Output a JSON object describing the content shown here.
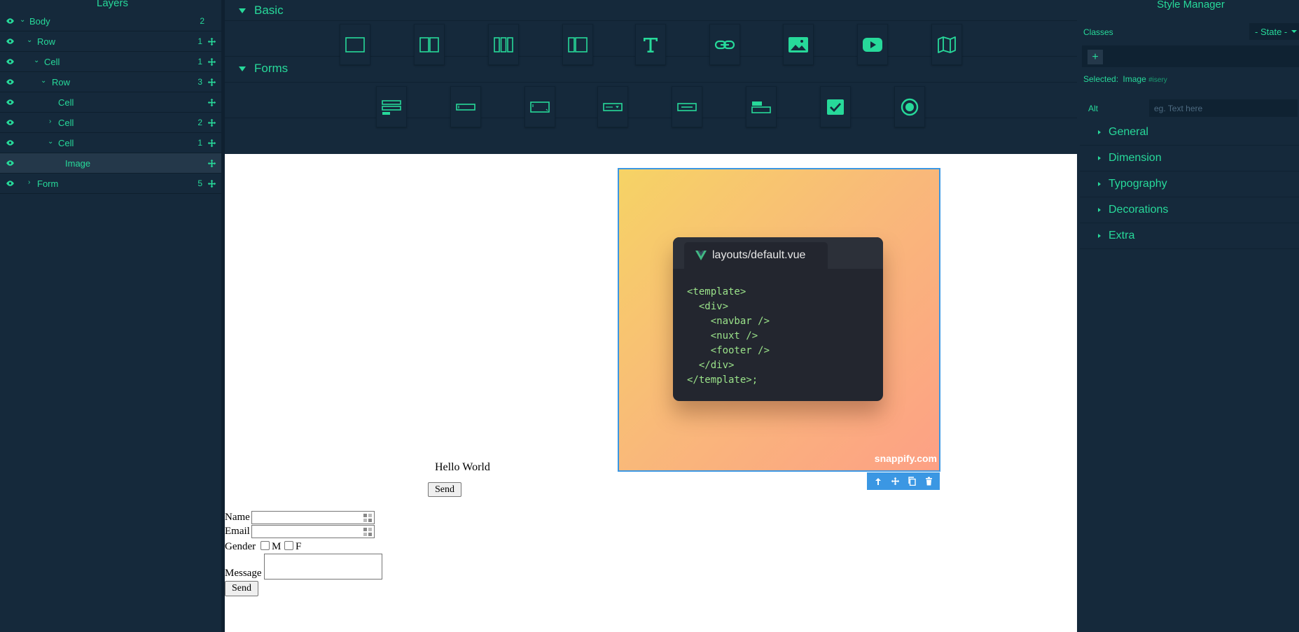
{
  "layers_panel": {
    "title": "Layers",
    "rows": [
      {
        "name": "Body",
        "count": "2"
      },
      {
        "name": "Row",
        "count": "1"
      },
      {
        "name": "Cell",
        "count": "1"
      },
      {
        "name": "Row",
        "count": "3"
      },
      {
        "name": "Cell",
        "count": ""
      },
      {
        "name": "Cell",
        "count": "2"
      },
      {
        "name": "Cell",
        "count": "1"
      },
      {
        "name": "Image",
        "count": ""
      },
      {
        "name": "Form",
        "count": "5"
      }
    ]
  },
  "blocks": {
    "basic": {
      "label": "Basic"
    },
    "forms": {
      "label": "Forms"
    }
  },
  "canvas": {
    "code_card": {
      "tab_title": "layouts/default.vue",
      "lines": [
        "<template>",
        "<div>",
        "<navbar />",
        "<nuxt />",
        "<footer />",
        "</div>",
        "</template>;"
      ]
    },
    "watermark": "snappify.com",
    "hello_text": "Hello World",
    "send_button_1": "Send",
    "form": {
      "name_label": "Name",
      "email_label": "Email",
      "gender_label": "Gender",
      "gender_m": "M",
      "gender_f": "F",
      "message_label": "Message",
      "send_button": "Send"
    }
  },
  "style_manager": {
    "title": "Style Manager",
    "classes_label": "Classes",
    "state_label": "- State -",
    "add_class_label": "+",
    "selected_label": "Selected:",
    "selected_value": "Image",
    "selected_id": "#isery",
    "alt_label": "Alt",
    "alt_placeholder": "eg. Text here",
    "sectors": [
      "General",
      "Dimension",
      "Typography",
      "Decorations",
      "Extra"
    ]
  },
  "colors": {
    "panel_bg": "#15293b",
    "accent": "#27d99a",
    "selection_blue": "#3b97e3",
    "canvas_bg": "#ffffff",
    "gradient_start": "#f6d365",
    "gradient_end": "#fda085",
    "code_bg": "#23262f"
  }
}
